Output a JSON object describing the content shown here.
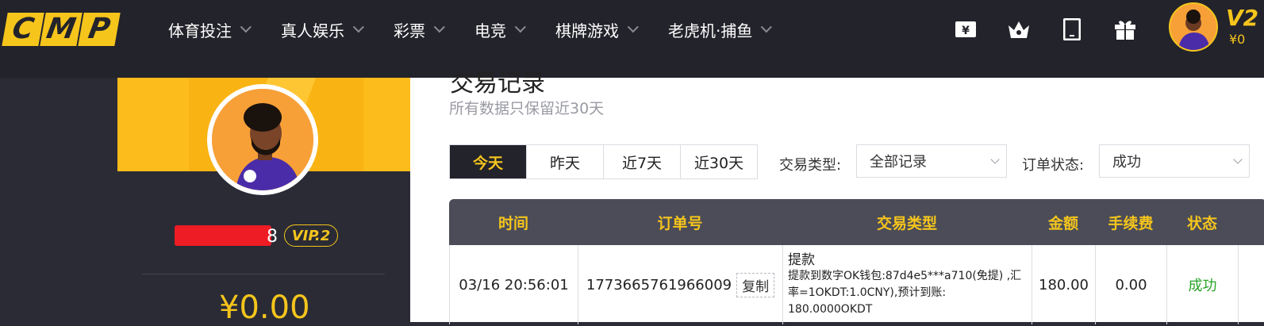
{
  "header": {
    "logo_letters": [
      "C",
      "M",
      "P"
    ],
    "nav": [
      {
        "label": "体育投注"
      },
      {
        "label": "真人娱乐"
      },
      {
        "label": "彩票"
      },
      {
        "label": "电竞"
      },
      {
        "label": "棋牌游戏"
      },
      {
        "label": "老虎机·捕鱼"
      }
    ],
    "icons": [
      "wallet-yen-icon",
      "crown-icon",
      "mobile-icon",
      "gift-icon"
    ],
    "user_vip": "V2",
    "user_balance": "¥0"
  },
  "profile": {
    "name_suffix": "8",
    "vip": "VIP.2",
    "balance": "¥0.00"
  },
  "main": {
    "note": "所有数据只保留近30天",
    "date_tabs": [
      {
        "label": "今天",
        "active": true
      },
      {
        "label": "昨天",
        "active": false
      },
      {
        "label": "近7天",
        "active": false
      },
      {
        "label": "近30天",
        "active": false
      }
    ],
    "type_filter_label": "交易类型:",
    "type_filter_value": "全部记录",
    "status_filter_label": "订单状态:",
    "status_filter_value": "成功"
  },
  "table": {
    "headers": [
      "时间",
      "订单号",
      "交易类型",
      "金额",
      "手续费",
      "状态"
    ],
    "rows": [
      {
        "time": "03/16 20:56:01",
        "order_no": "1773665761966009",
        "copy_label": "复制",
        "type_title": "提款",
        "type_desc": "提款到数字OK钱包:87d4e5***a710(免提) ,汇率=1OKDT:1.0CNY),预计到账: 180.0000OKDT",
        "amount": "180.00",
        "fee": "0.00",
        "status": "成功"
      }
    ]
  },
  "colors": {
    "accent": "#f5c51c",
    "nav_bg": "#23232b",
    "success": "#2aa52a",
    "redaction": "#ee1c24"
  }
}
